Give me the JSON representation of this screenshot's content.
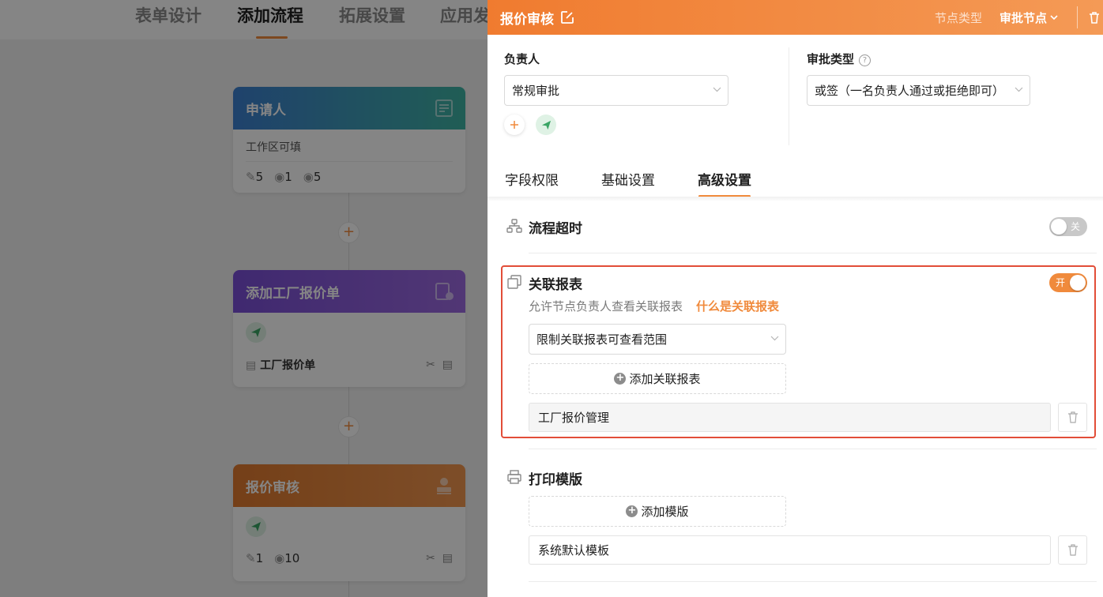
{
  "background": {
    "tabs": [
      "表单设计",
      "添加流程",
      "拓展设置",
      "应用发"
    ],
    "active_tab_index": 1,
    "nodes": [
      {
        "title": "申请人",
        "subtitle": "工作区可填",
        "stats": [
          "5",
          "1",
          "5"
        ],
        "color_from": "#3d7fd0",
        "color_to": "#3fb3a3"
      },
      {
        "title": "添加工厂报价单",
        "form_name": "工厂报价单",
        "color_from": "#7a4fd6",
        "color_to": "#9c6ae0"
      },
      {
        "title": "报价审核",
        "stats": [
          "1",
          "10"
        ],
        "color_from": "#e07a2f",
        "color_to": "#f0964f"
      }
    ],
    "add_symbol": "+"
  },
  "drawer": {
    "title": "报价审核",
    "node_type_label": "节点类型",
    "node_type_value": "审批节点",
    "owner_label": "负责人",
    "owner_select": "常规审批",
    "approval_type_label": "审批类型",
    "approval_type_select": "或签（一名负责人通过或拒绝即可）",
    "help_symbol": "?",
    "tabs": [
      "字段权限",
      "基础设置",
      "高级设置"
    ],
    "active_tab_index": 2,
    "sections": {
      "timeout": {
        "title": "流程超时",
        "toggle_text": "关",
        "enabled": false
      },
      "linked_report": {
        "title": "关联报表",
        "toggle_text": "开",
        "enabled": true,
        "description": "允许节点负责人查看关联报表",
        "help_link": "什么是关联报表",
        "scope_select": "限制关联报表可查看范围",
        "add_button": "添加关联报表",
        "items": [
          "工厂报价管理"
        ]
      },
      "print_template": {
        "title": "打印模版",
        "add_button": "添加模版",
        "items": [
          "系统默认模板"
        ]
      }
    }
  },
  "colors": {
    "accent": "#f08a3c",
    "highlight_border": "#e24d38",
    "toggle_off": "#c8c8c8"
  }
}
